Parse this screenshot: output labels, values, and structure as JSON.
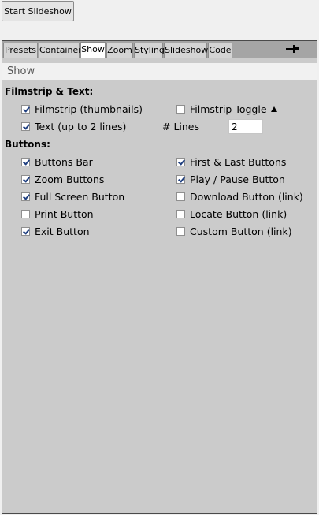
{
  "toolbar": {
    "start_slideshow_label": "Start Slideshow"
  },
  "tabs": [
    {
      "label": "Presets"
    },
    {
      "label": "Container"
    },
    {
      "label": "Show"
    },
    {
      "label": "Zoom"
    },
    {
      "label": "Styling"
    },
    {
      "label": "Slideshow"
    },
    {
      "label": "Code"
    }
  ],
  "active_tab": "Show",
  "pin_icon": "pin-icon",
  "header": {
    "title": "Show"
  },
  "filmstrip_section": {
    "title": "Filmstrip & Text:",
    "filmstrip": {
      "label": "Filmstrip (thumbnails)",
      "checked": true
    },
    "filmstrip_toggle": {
      "label": "Filmstrip Toggle",
      "checked": false
    },
    "text": {
      "label": "Text (up to 2 lines)",
      "checked": true
    },
    "lines": {
      "label": "# Lines",
      "value": "2"
    }
  },
  "buttons_section": {
    "title": "Buttons:",
    "left": [
      {
        "label": "Buttons Bar",
        "checked": true
      },
      {
        "label": "Zoom Buttons",
        "checked": true
      },
      {
        "label": "Full Screen Button",
        "checked": true
      },
      {
        "label": "Print Button",
        "checked": false
      },
      {
        "label": "Exit Button",
        "checked": true
      }
    ],
    "right": [
      {
        "label": "First & Last Buttons",
        "checked": true
      },
      {
        "label": "Play / Pause Button",
        "checked": true
      },
      {
        "label": "Download Button (link)",
        "checked": false
      },
      {
        "label": "Locate Button (link)",
        "checked": false
      },
      {
        "label": "Custom Button (link)",
        "checked": false
      }
    ]
  }
}
